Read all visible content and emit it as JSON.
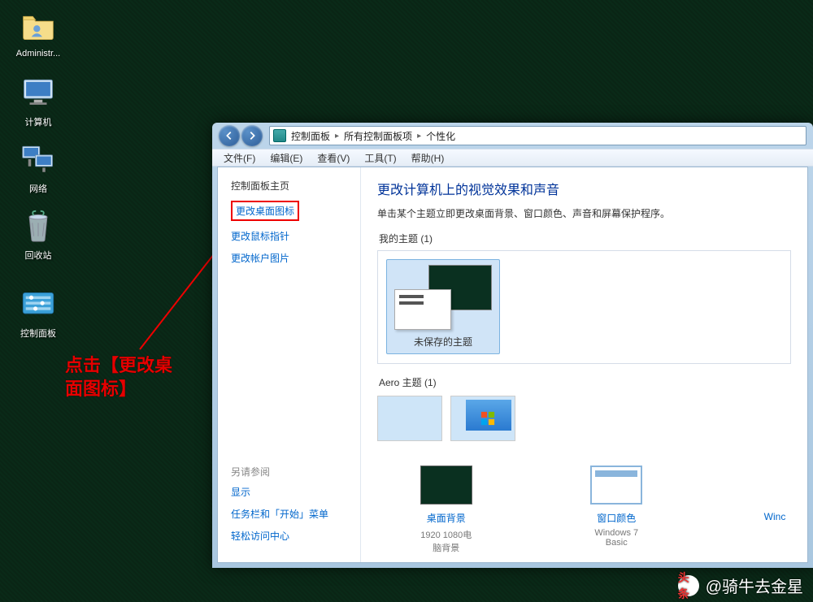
{
  "desktop": {
    "icons": [
      {
        "label": "Administr..."
      },
      {
        "label": "计算机"
      },
      {
        "label": "网络"
      },
      {
        "label": "回收站"
      },
      {
        "label": "控制面板"
      }
    ]
  },
  "annotation": {
    "line1": "点击【更改桌",
    "line2": "面图标】"
  },
  "window": {
    "breadcrumb": {
      "root": "控制面板",
      "mid": "所有控制面板项",
      "leaf": "个性化"
    },
    "menu": {
      "file": "文件(F)",
      "edit": "编辑(E)",
      "view": "查看(V)",
      "tools": "工具(T)",
      "help": "帮助(H)"
    },
    "sidebar": {
      "home": "控制面板主页",
      "change_desktop_icons": "更改桌面图标",
      "change_pointer": "更改鼠标指针",
      "change_account_pic": "更改帐户图片",
      "seealso_title": "另请参阅",
      "seealso": {
        "display": "显示",
        "taskbar": "任务栏和「开始」菜单",
        "ease": "轻松访问中心"
      }
    },
    "main": {
      "heading": "更改计算机上的视觉效果和声音",
      "subtext": "单击某个主题立即更改桌面背景、窗口颜色、声音和屏幕保护程序。",
      "my_themes_label": "我的主题 (1)",
      "my_theme_name": "未保存的主题",
      "aero_label": "Aero 主题 (1)",
      "bottom": {
        "wallpaper_name": "桌面背景",
        "wallpaper_desc": "1920 1080电脑背景",
        "wincolor_name": "窗口颜色",
        "wincolor_desc": "Windows 7 Basic",
        "cut_name": "Winc"
      }
    }
  },
  "watermark": {
    "brand": "头条",
    "author": "@骑牛去金星"
  }
}
